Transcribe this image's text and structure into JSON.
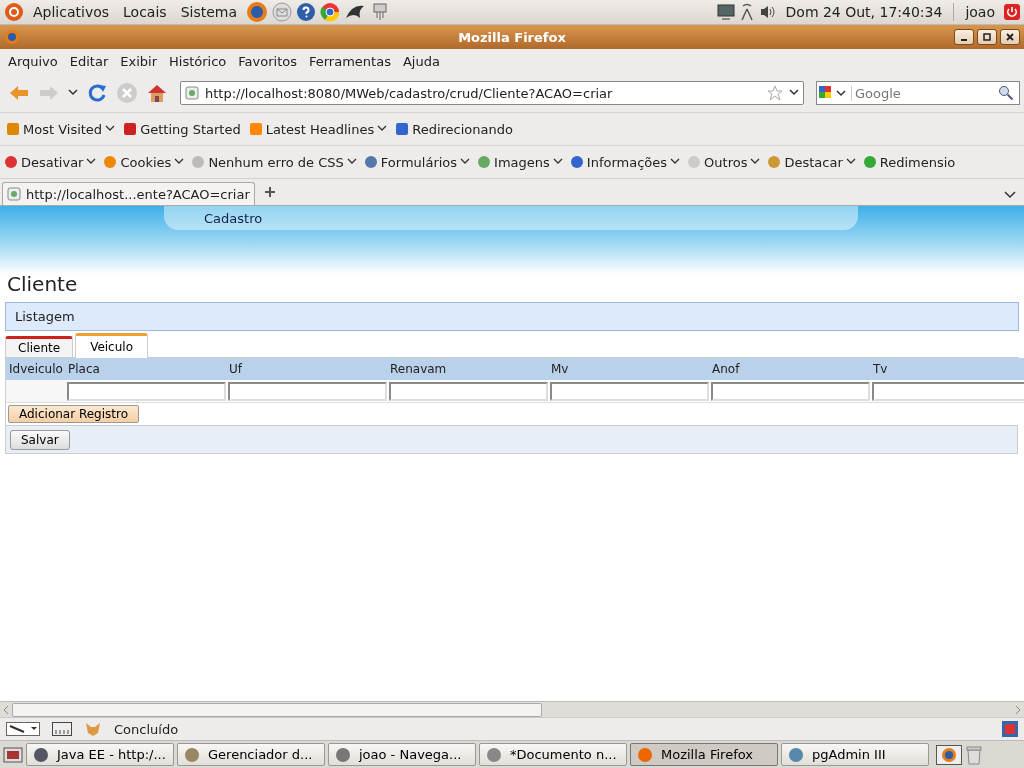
{
  "top_panel": {
    "menus": [
      "Aplicativos",
      "Locais",
      "Sistema"
    ],
    "clock": "Dom 24 Out, 17:40:34",
    "user": "joao"
  },
  "window": {
    "title": "Mozilla Firefox"
  },
  "menu_bar": [
    "Arquivo",
    "Editar",
    "Exibir",
    "Histórico",
    "Favoritos",
    "Ferramentas",
    "Ajuda"
  ],
  "nav": {
    "url": "http://localhost:8080/MWeb/cadastro/crud/Cliente?ACAO=criar",
    "search_placeholder": "Google"
  },
  "bookmarks": [
    {
      "label": "Most Visited",
      "dropdown": true
    },
    {
      "label": "Getting Started",
      "dropdown": false
    },
    {
      "label": "Latest Headlines",
      "dropdown": true
    },
    {
      "label": "Redirecionando",
      "dropdown": false
    }
  ],
  "dev_toolbar": [
    "Desativar",
    "Cookies",
    "Nenhum erro de CSS",
    "Formulários",
    "Imagens",
    "Informações",
    "Outros",
    "Destacar",
    "Redimensio"
  ],
  "browser_tab": {
    "label": "http://localhost...ente?ACAO=criar"
  },
  "page": {
    "banner_link": "Cadastro",
    "heading": "Cliente",
    "panel": "Listagem",
    "tabs": [
      {
        "label": "Cliente",
        "selected": false
      },
      {
        "label": "Veiculo",
        "selected": true
      }
    ],
    "table": {
      "columns": [
        "Idveiculo",
        "Placa",
        "Uf",
        "Renavam",
        "Mv",
        "Anof",
        "Tv"
      ]
    },
    "add_button": "Adicionar Registro",
    "save_button": "Salvar"
  },
  "status_bar": {
    "text": "Concluído"
  },
  "taskbar": [
    {
      "label": "Java EE - http:/...",
      "selected": false
    },
    {
      "label": "Gerenciador d...",
      "selected": false
    },
    {
      "label": "joao - Navega...",
      "selected": false
    },
    {
      "label": "*Documento n...",
      "selected": false
    },
    {
      "label": "Mozilla Firefox",
      "selected": true
    },
    {
      "label": "pgAdmin III",
      "selected": false
    }
  ]
}
